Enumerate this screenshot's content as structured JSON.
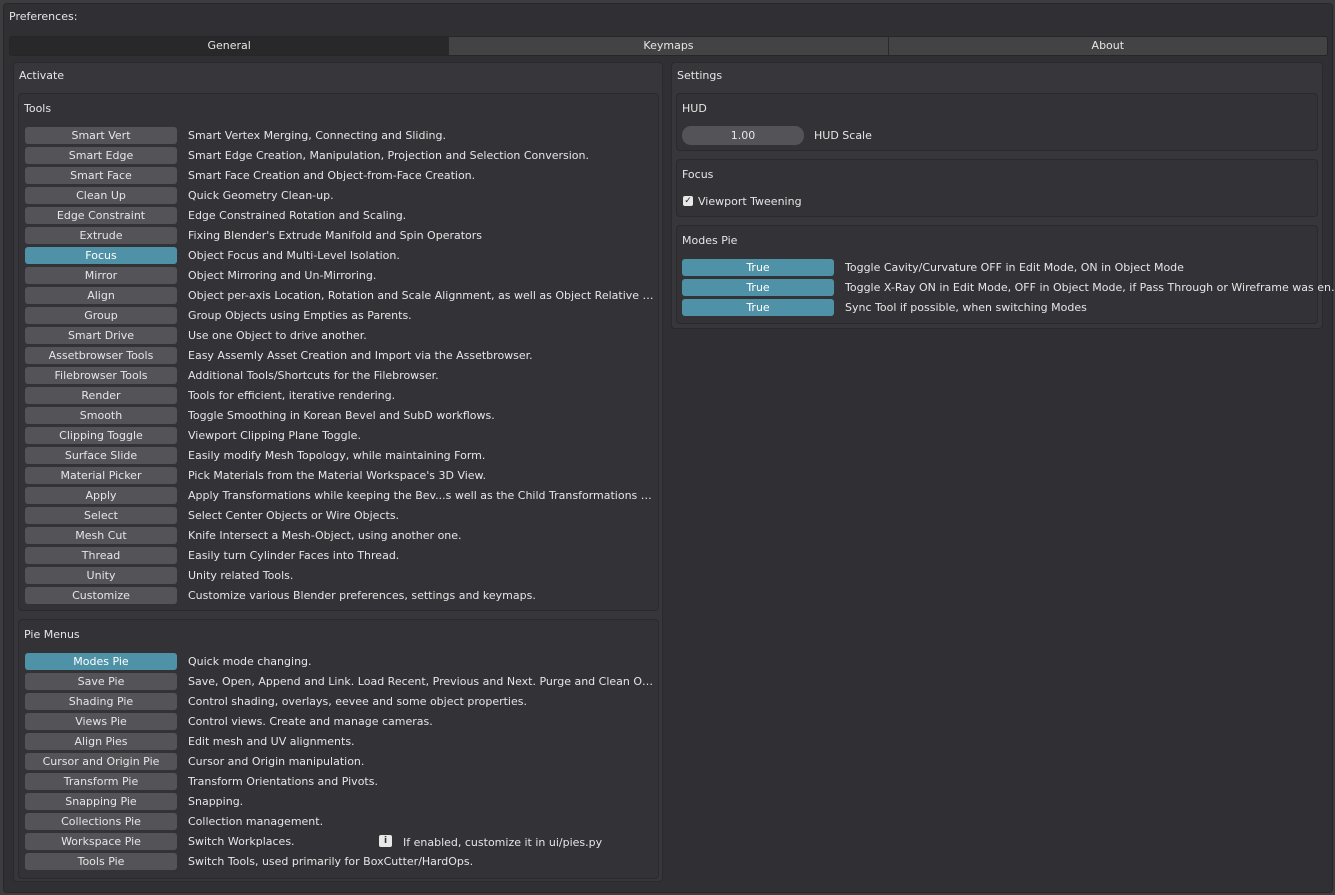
{
  "window": {
    "title": "Preferences:"
  },
  "tabs": [
    {
      "label": "General",
      "active": true
    },
    {
      "label": "Keymaps",
      "active": false
    },
    {
      "label": "About",
      "active": false
    }
  ],
  "activate": {
    "title": "Activate",
    "tools": {
      "title": "Tools",
      "items": [
        {
          "label": "Smart Vert",
          "desc": "Smart Vertex Merging, Connecting and Sliding.",
          "on": false
        },
        {
          "label": "Smart Edge",
          "desc": "Smart Edge Creation, Manipulation, Projection and Selection Conversion.",
          "on": false
        },
        {
          "label": "Smart Face",
          "desc": "Smart Face Creation and Object-from-Face Creation.",
          "on": false
        },
        {
          "label": "Clean Up",
          "desc": "Quick Geometry Clean-up.",
          "on": false
        },
        {
          "label": "Edge Constraint",
          "desc": "Edge Constrained Rotation and Scaling.",
          "on": false
        },
        {
          "label": "Extrude",
          "desc": "Fixing Blender's Extrude Manifold and Spin Operators",
          "on": false
        },
        {
          "label": "Focus",
          "desc": "Object Focus and Multi-Level Isolation.",
          "on": true
        },
        {
          "label": "Mirror",
          "desc": "Object Mirroring and Un-Mirroring.",
          "on": false
        },
        {
          "label": "Align",
          "desc": "Object per-axis Location, Rotation and Scale Alignment, as well as Object Relative Alignmen...",
          "on": false
        },
        {
          "label": "Group",
          "desc": "Group Objects using Empties as Parents.",
          "on": false
        },
        {
          "label": "Smart Drive",
          "desc": "Use one Object to drive another.",
          "on": false
        },
        {
          "label": "Assetbrowser Tools",
          "desc": "Easy Assemly Asset Creation and Import via the Assetbrowser.",
          "on": false
        },
        {
          "label": "Filebrowser Tools",
          "desc": "Additional Tools/Shortcuts for the Filebrowser.",
          "on": false
        },
        {
          "label": "Render",
          "desc": "Tools for efficient, iterative rendering.",
          "on": false
        },
        {
          "label": "Smooth",
          "desc": "Toggle Smoothing in Korean Bevel and SubD workflows.",
          "on": false
        },
        {
          "label": "Clipping Toggle",
          "desc": "Viewport Clipping Plane Toggle.",
          "on": false
        },
        {
          "label": "Surface Slide",
          "desc": "Easily modify Mesh Topology, while maintaining Form.",
          "on": false
        },
        {
          "label": "Material Picker",
          "desc": "Pick Materials from the Material Workspace's 3D View.",
          "on": false
        },
        {
          "label": "Apply",
          "desc": "Apply Transformations while keeping the Bev...s well as the Child Transformations unchanged.",
          "on": false
        },
        {
          "label": "Select",
          "desc": "Select Center Objects or Wire Objects.",
          "on": false
        },
        {
          "label": "Mesh Cut",
          "desc": "Knife Intersect a Mesh-Object, using another one.",
          "on": false
        },
        {
          "label": "Thread",
          "desc": "Easily turn Cylinder Faces into Thread.",
          "on": false
        },
        {
          "label": "Unity",
          "desc": "Unity related Tools.",
          "on": false
        },
        {
          "label": "Customize",
          "desc": "Customize various Blender preferences, settings and keymaps.",
          "on": false
        }
      ]
    },
    "pies": {
      "title": "Pie Menus",
      "items": [
        {
          "label": "Modes Pie",
          "desc": "Quick mode changing.",
          "on": true
        },
        {
          "label": "Save Pie",
          "desc": "Save, Open, Append and Link. Load Recent, Previous and Next. Purge and Clean Out. Screen...",
          "on": false
        },
        {
          "label": "Shading Pie",
          "desc": "Control shading, overlays, eevee and some object properties.",
          "on": false
        },
        {
          "label": "Views Pie",
          "desc": "Control views. Create and manage cameras.",
          "on": false
        },
        {
          "label": "Align Pies",
          "desc": "Edit mesh and UV alignments.",
          "on": false
        },
        {
          "label": "Cursor and Origin Pie",
          "desc": "Cursor and Origin manipulation.",
          "on": false
        },
        {
          "label": "Transform Pie",
          "desc": "Transform Orientations and Pivots.",
          "on": false
        },
        {
          "label": "Snapping Pie",
          "desc": "Snapping.",
          "on": false
        },
        {
          "label": "Collections Pie",
          "desc": "Collection management.",
          "on": false
        },
        {
          "label": "Workspace Pie",
          "desc": "Switch Workplaces.",
          "on": false
        },
        {
          "label": "Tools Pie",
          "desc": "Switch Tools, used primarily for BoxCutter/HardOps.",
          "on": false
        }
      ],
      "workspace_note": "If enabled, customize it in ui/pies.py",
      "info_icon_glyph": "i"
    }
  },
  "settings": {
    "title": "Settings",
    "hud": {
      "title": "HUD",
      "scale_value": "1.00",
      "scale_label": "HUD Scale"
    },
    "focus": {
      "title": "Focus",
      "tween_label": "Viewport Tweening",
      "tween_checked": true,
      "check_glyph": "✓"
    },
    "modes_pie": {
      "title": "Modes Pie",
      "items": [
        {
          "value": "True",
          "desc": "Toggle Cavity/Curvature OFF in Edit Mode, ON in Object Mode"
        },
        {
          "value": "True",
          "desc": "Toggle X-Ray ON in Edit Mode, OFF in Object Mode, if Pass Through or Wireframe was enabled in E..."
        },
        {
          "value": "True",
          "desc": "Sync Tool if possible, when switching Modes"
        }
      ]
    }
  },
  "colors": {
    "active_button": "#4f92a8",
    "button": "#545458",
    "background": "#303034"
  }
}
